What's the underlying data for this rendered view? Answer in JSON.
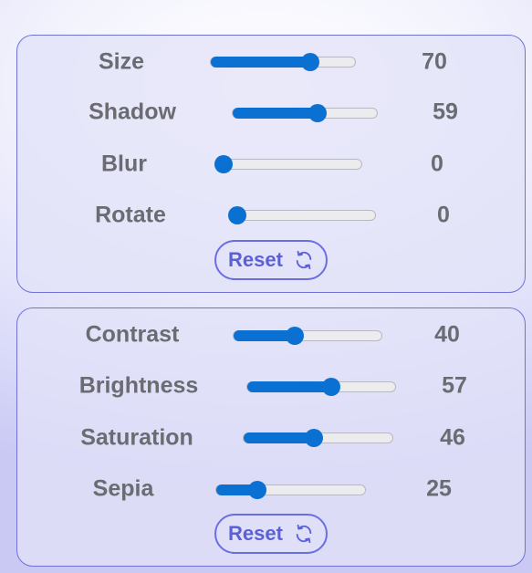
{
  "panels": [
    {
      "reset_label": "Reset",
      "reset_icon": "refresh-icon",
      "sliders": [
        {
          "label": "Size",
          "value": "70",
          "level": 70
        },
        {
          "label": "Shadow",
          "value": "59",
          "level": 59
        },
        {
          "label": "Blur",
          "value": "0",
          "level": 0
        },
        {
          "label": "Rotate",
          "value": "0",
          "level": 0
        }
      ]
    },
    {
      "reset_label": "Reset",
      "reset_icon": "refresh-icon",
      "sliders": [
        {
          "label": "Contrast",
          "value": "40",
          "level": 40
        },
        {
          "label": "Brightness",
          "value": "57",
          "level": 57
        },
        {
          "label": "Saturation",
          "value": "46",
          "level": 46
        },
        {
          "label": "Sepia",
          "value": "25",
          "level": 25
        }
      ]
    }
  ],
  "colors": {
    "accent": "#0a70d2",
    "button": "#5b60d6",
    "panel_border": "#6f73d8",
    "text": "#6b6b72"
  }
}
